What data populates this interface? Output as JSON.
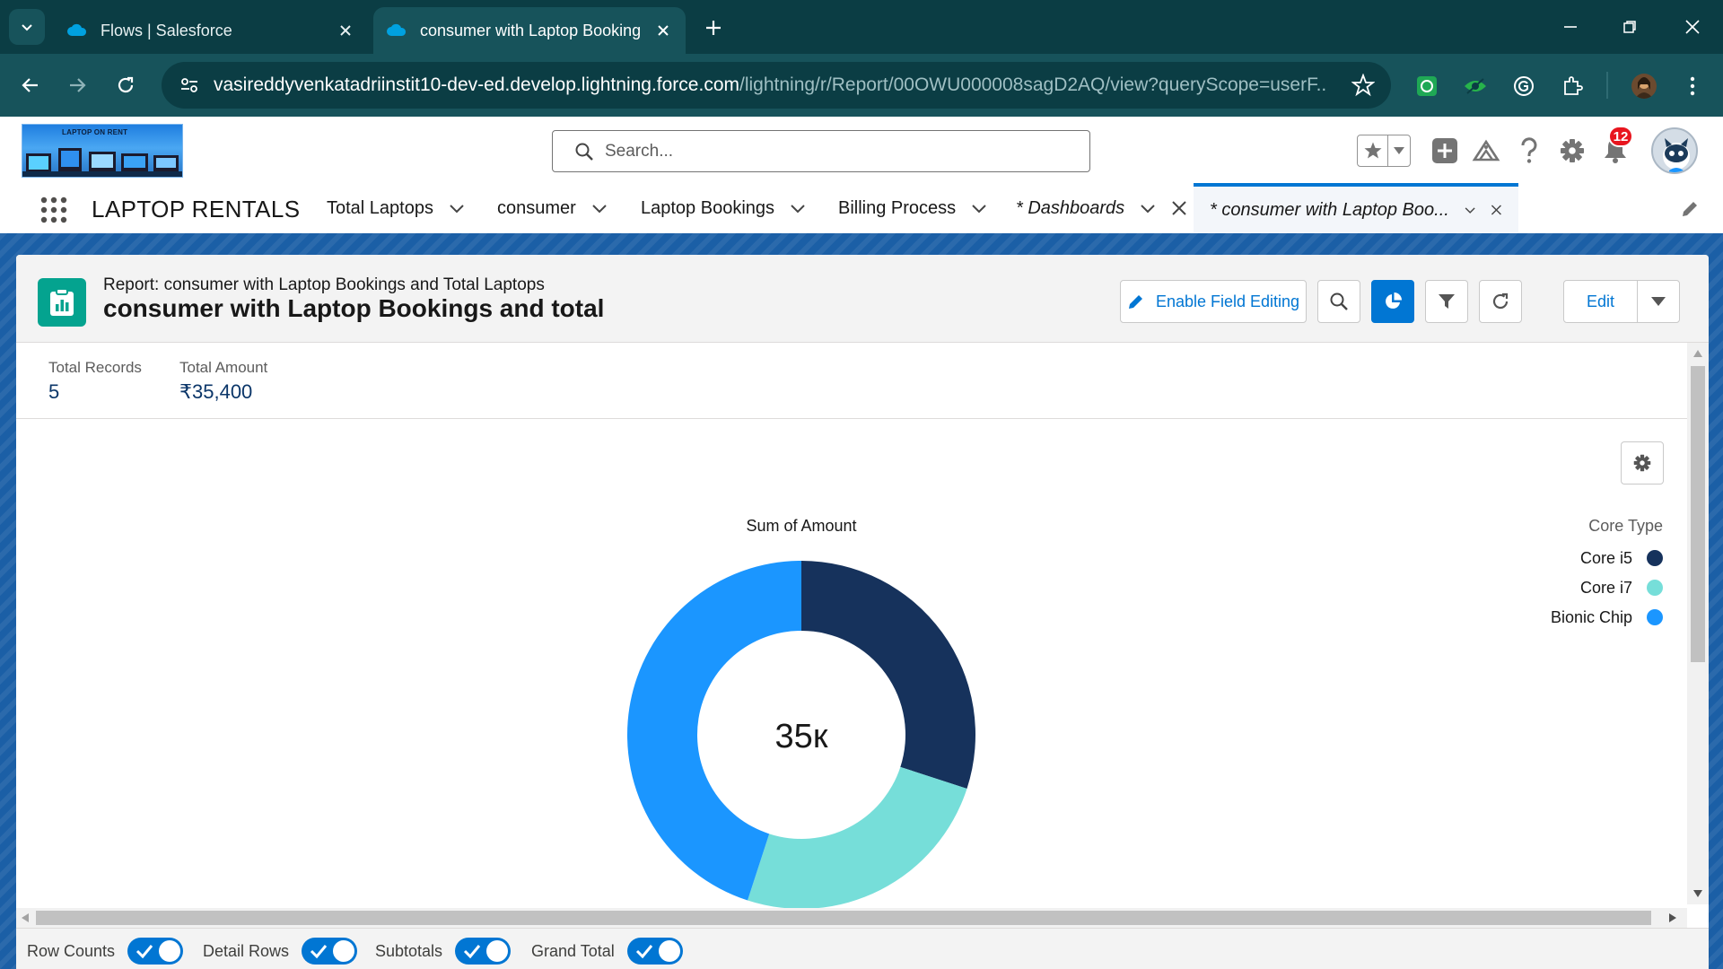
{
  "browser": {
    "tabs": [
      {
        "title": "Flows | Salesforce",
        "active": false
      },
      {
        "title": "consumer with Laptop Booking",
        "active": true
      }
    ],
    "url_host": "vasireddyvenkatadriinstit10-dev-ed.develop.lightning.force.com",
    "url_path": "/lightning/r/Report/00OWU000008sagD2AQ/view?queryScope=userF..."
  },
  "header": {
    "logo_text": "LAPTOP ON RENT",
    "search_placeholder": "Search...",
    "notification_count": "12"
  },
  "nav": {
    "app_name": "LAPTOP RENTALS",
    "items": [
      {
        "label": "Total Laptops"
      },
      {
        "label": "consumer"
      },
      {
        "label": "Laptop Bookings"
      },
      {
        "label": "Billing Process"
      },
      {
        "label": "* Dashboards"
      },
      {
        "label": "* consumer with Laptop Boo..."
      }
    ]
  },
  "report": {
    "subtitle": "Report: consumer with Laptop Bookings and Total Laptops",
    "title": "consumer with Laptop Bookings and total",
    "enable_field_editing": "Enable Field Editing",
    "edit_label": "Edit",
    "summary": {
      "total_records_label": "Total Records",
      "total_records_value": "5",
      "total_amount_label": "Total Amount",
      "total_amount_value": "₹35,400"
    }
  },
  "chart_data": {
    "type": "pie",
    "variant": "donut",
    "title": "Sum of Amount",
    "center_label": "35к",
    "legend_title": "Core Type",
    "legend_position": "right",
    "categories": [
      "Core i5",
      "Core i7",
      "Bionic Chip"
    ],
    "values": [
      10620,
      8850,
      15930
    ],
    "colors": [
      "#16325c",
      "#76ded9",
      "#1b96ff"
    ]
  },
  "footer": {
    "toggles": [
      {
        "label": "Row Counts",
        "on": true
      },
      {
        "label": "Detail Rows",
        "on": true
      },
      {
        "label": "Subtotals",
        "on": true
      },
      {
        "label": "Grand Total",
        "on": true
      }
    ]
  }
}
